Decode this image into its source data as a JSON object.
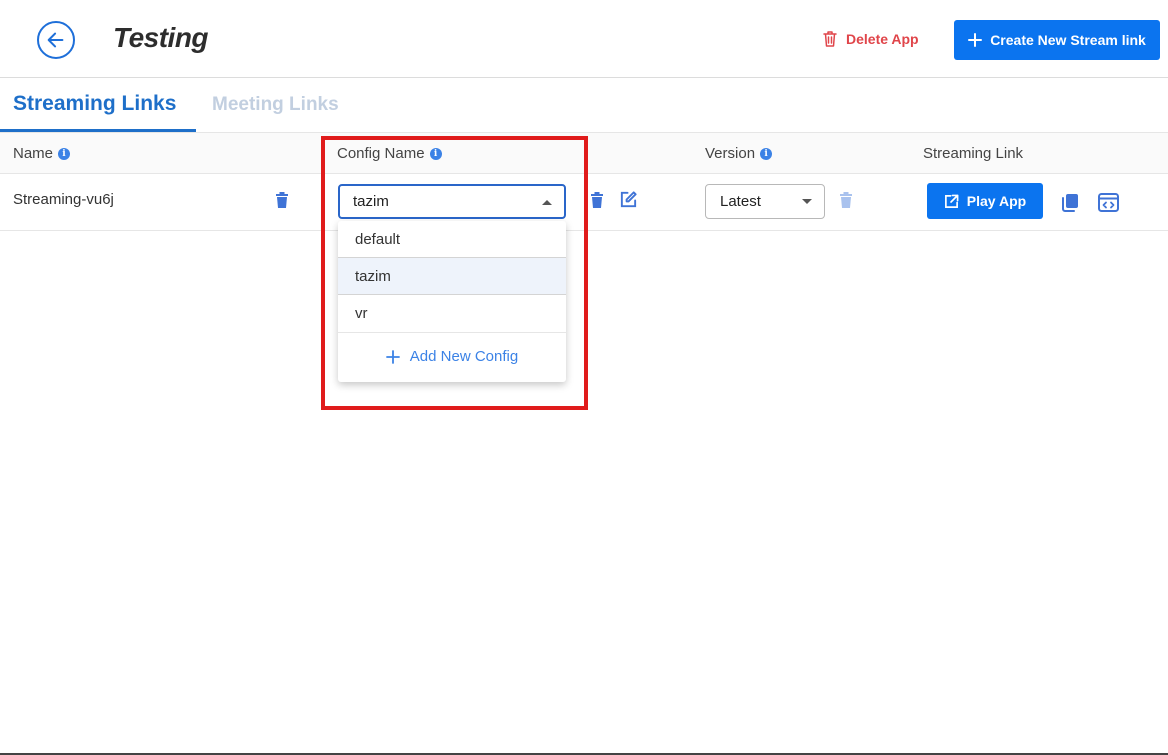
{
  "header": {
    "title": "Testing",
    "delete_label": "Delete App",
    "create_label": "Create New Stream link"
  },
  "tabs": [
    {
      "label": "Streaming Links",
      "active": true
    },
    {
      "label": "Meeting Links",
      "active": false
    }
  ],
  "table": {
    "columns": [
      {
        "label": "Name",
        "info": true
      },
      {
        "label": "Config Name",
        "info": true
      },
      {
        "label": "Version",
        "info": true
      },
      {
        "label": "Streaming Link",
        "info": false
      }
    ],
    "rows": [
      {
        "name": "Streaming-vu6j",
        "config_value": "tazim",
        "version_value": "Latest",
        "play_label": "Play App"
      }
    ]
  },
  "config_dropdown": {
    "options": [
      "default",
      "tazim",
      "vr"
    ],
    "selected": "tazim",
    "add_label": "Add New Config"
  },
  "colors": {
    "primary": "#0b74ef",
    "tab_active": "#1e6fc9",
    "danger": "#e0454a",
    "highlight": "#e01b1b"
  },
  "icons": [
    "back-arrow-icon",
    "trash-icon",
    "plus-icon",
    "info-icon",
    "edit-icon",
    "external-link-icon",
    "copy-icon",
    "embed-icon"
  ]
}
